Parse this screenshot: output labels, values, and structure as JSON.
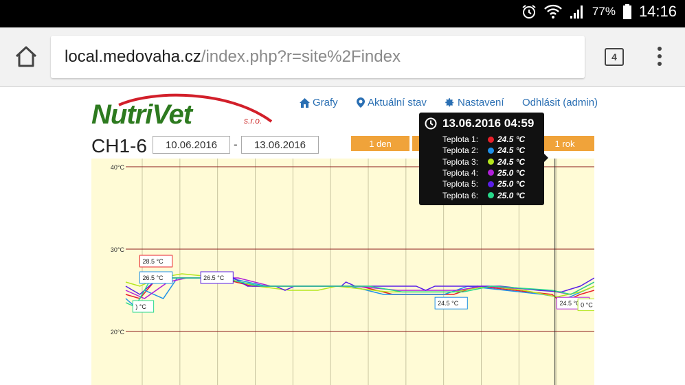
{
  "status_bar": {
    "battery_percent": "77%",
    "time": "14:16"
  },
  "browser": {
    "url_host": "local.medovaha.cz",
    "url_path": "/index.php?r=site%2Findex",
    "tab_count": "4"
  },
  "logo": {
    "brand": "NutriVet",
    "suffix": "s.r.o."
  },
  "nav": {
    "grafy": "Grafy",
    "aktualni": "Aktuální stav",
    "nastaveni": "Nastavení",
    "odhlasit": "Odhlásit (admin)"
  },
  "page_title": "CH1-6",
  "date_from": "10.06.2016",
  "date_separator": "-",
  "date_to": "13.06.2016",
  "range_buttons": {
    "day": "1 den",
    "year": "1 rok"
  },
  "tooltip": {
    "datetime": "13.06.2016 04:59",
    "rows": [
      {
        "label": "Teplota 1:",
        "value": "24.5 °C",
        "color": "#e8202a"
      },
      {
        "label": "Teplota 2:",
        "value": "24.5 °C",
        "color": "#1e90e8"
      },
      {
        "label": "Teplota 3:",
        "value": "24.5 °C",
        "color": "#b5e61d"
      },
      {
        "label": "Teplota 4:",
        "value": "25.0 °C",
        "color": "#b01ed8"
      },
      {
        "label": "Teplota 5:",
        "value": "25.0 °C",
        "color": "#5a1ee8"
      },
      {
        "label": "Teplota 6:",
        "value": "25.0 °C",
        "color": "#27d98a"
      }
    ]
  },
  "chart_data": {
    "type": "line",
    "ytick_labels": [
      "40°C",
      "30°C",
      "20°C"
    ],
    "yticks": [
      40,
      30,
      20
    ],
    "ylim": [
      13.5,
      41
    ],
    "xlim": [
      0,
      100
    ],
    "vertical_gridlines": 12,
    "crosshair_x": 91.6,
    "background": "#fffbd6",
    "series": [
      {
        "color": "#e8202a",
        "points": [
          [
            0,
            24.5
          ],
          [
            3,
            24
          ],
          [
            6,
            26
          ],
          [
            10,
            26.5
          ],
          [
            20,
            26.5
          ],
          [
            27,
            25.5
          ],
          [
            50,
            25.5
          ],
          [
            57,
            24.5
          ],
          [
            70,
            24.5
          ],
          [
            75,
            25.5
          ],
          [
            91,
            24.5
          ],
          [
            93,
            23.5
          ],
          [
            97,
            24.5
          ],
          [
            100,
            25
          ]
        ]
      },
      {
        "color": "#1e90e8",
        "points": [
          [
            0,
            24
          ],
          [
            2,
            23
          ],
          [
            4,
            25
          ],
          [
            8,
            24
          ],
          [
            11,
            26.5
          ],
          [
            22,
            26.5
          ],
          [
            30,
            25.5
          ],
          [
            48,
            25.5
          ],
          [
            55,
            24.5
          ],
          [
            68,
            24.5
          ],
          [
            73,
            25.5
          ],
          [
            89,
            24.5
          ],
          [
            94,
            24
          ],
          [
            98,
            25
          ],
          [
            100,
            25.5
          ]
        ]
      },
      {
        "color": "#b5e61d",
        "points": [
          [
            0,
            26
          ],
          [
            3,
            25.5
          ],
          [
            7,
            26.5
          ],
          [
            12,
            27
          ],
          [
            21,
            26.5
          ],
          [
            28,
            25.5
          ],
          [
            35,
            25
          ],
          [
            41,
            25
          ],
          [
            45,
            25.5
          ],
          [
            56,
            24.8
          ],
          [
            70,
            24.8
          ],
          [
            77,
            25.5
          ],
          [
            85,
            25
          ],
          [
            92,
            24.2
          ],
          [
            97,
            24.8
          ],
          [
            100,
            25.5
          ]
        ]
      },
      {
        "color": "#b01ed8",
        "points": [
          [
            0,
            25
          ],
          [
            4,
            24
          ],
          [
            9,
            26
          ],
          [
            13,
            26.5
          ],
          [
            24,
            26.5
          ],
          [
            31,
            25.5
          ],
          [
            49,
            25.5
          ],
          [
            58,
            25
          ],
          [
            71,
            25
          ],
          [
            76,
            25.5
          ],
          [
            90,
            25
          ],
          [
            95,
            24.5
          ],
          [
            100,
            26
          ]
        ]
      },
      {
        "color": "#5a1ee8",
        "points": [
          [
            0,
            25.5
          ],
          [
            3,
            24.5
          ],
          [
            6,
            26
          ],
          [
            10,
            26.5
          ],
          [
            23,
            26.5
          ],
          [
            26,
            25.5
          ],
          [
            32,
            25.5
          ],
          [
            34,
            25
          ],
          [
            36,
            25.5
          ],
          [
            46,
            25.5
          ],
          [
            47,
            26
          ],
          [
            49,
            25.5
          ],
          [
            62,
            25.5
          ],
          [
            64,
            25
          ],
          [
            66,
            25.5
          ],
          [
            80,
            25.5
          ],
          [
            88,
            25
          ],
          [
            93,
            24.8
          ],
          [
            97,
            25.5
          ],
          [
            100,
            26.5
          ]
        ]
      },
      {
        "color": "#27d98a",
        "points": [
          [
            0,
            23.5
          ],
          [
            2,
            23
          ],
          [
            5,
            26
          ],
          [
            9,
            26.5
          ],
          [
            20,
            26.5
          ],
          [
            29,
            25.5
          ],
          [
            52,
            25.5
          ],
          [
            59,
            24.8
          ],
          [
            72,
            24.8
          ],
          [
            78,
            25.5
          ],
          [
            91,
            25
          ],
          [
            95,
            24.5
          ],
          [
            100,
            26
          ]
        ]
      }
    ],
    "data_labels": [
      {
        "text": "28.5 °C",
        "color": "#e8202a",
        "x": 3,
        "y": 28.5
      },
      {
        "text": "26.5 °C",
        "color": "#1e90e8",
        "x": 3,
        "y": 26.5
      },
      {
        "text": "26.5 °C",
        "color": "#5a1ee8",
        "x": 16,
        "y": 26.5
      },
      {
        "text": ") °C",
        "color": "#27d98a",
        "x": 1.5,
        "y": 23
      },
      {
        "text": "24.5 °C",
        "color": "#1e90e8",
        "x": 66,
        "y": 23.4
      },
      {
        "text": "24.5 °C",
        "color": "#b01ed8",
        "x": 92,
        "y": 23.4
      },
      {
        "text": "0 °C",
        "color": "#b5e61d",
        "x": 96.5,
        "y": 23.2
      }
    ]
  }
}
